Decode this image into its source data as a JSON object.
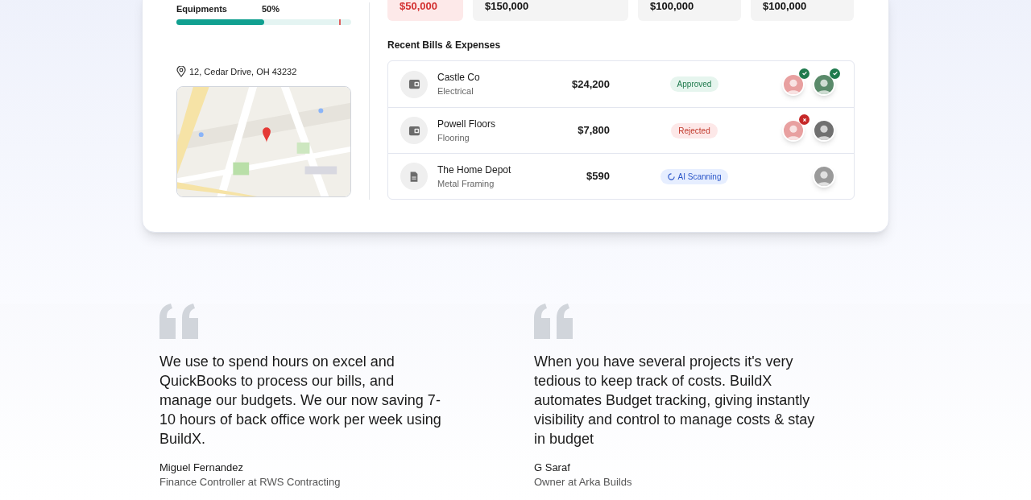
{
  "budget": {
    "label": "Equipments",
    "percent": "50%",
    "level": 0.5
  },
  "address": "12, Cedar Drive, OH 43232",
  "stats": [
    {
      "kind": "overdue",
      "value": "$50,000"
    },
    {
      "kind": "normal",
      "value": "$150,000"
    },
    {
      "kind": "normal",
      "value": "$100,000"
    },
    {
      "kind": "normal",
      "value": "$100,000"
    }
  ],
  "bills_title": "Recent Bills & Expenses",
  "bills": [
    {
      "kind": "wallet",
      "vendor": "Castle Co",
      "category": "Electrical",
      "amount": "$24,200",
      "status": {
        "kind": "approved",
        "label": "Approved"
      },
      "approvers": [
        {
          "kind": "approved",
          "color": "#e8a0a0"
        },
        {
          "kind": "approved",
          "color": "#5a8a6a"
        }
      ]
    },
    {
      "kind": "wallet",
      "vendor": "Powell Floors",
      "category": "Flooring",
      "amount": "$7,800",
      "status": {
        "kind": "rejected",
        "label": "Rejected"
      },
      "approvers": [
        {
          "kind": "rejected",
          "color": "#e8a0a0"
        },
        {
          "kind": "pending",
          "color": "#707070"
        }
      ]
    },
    {
      "kind": "document",
      "vendor": "The Home Depot",
      "category": "Metal Framing",
      "amount": "$590",
      "status": {
        "kind": "scanning",
        "label": "AI Scanning"
      },
      "approvers": [
        {
          "kind": "pending",
          "color": "#9a9a9a"
        }
      ]
    }
  ],
  "testimonials": [
    {
      "quote": "We use to spend hours on excel and QuickBooks to process our bills, and manage our budgets. We our now saving 7-10 hours of back office work per week using BuildX.",
      "name": "Miguel Fernandez",
      "role": "Finance Controller at RWS Contracting"
    },
    {
      "quote": "When you have several projects it's very tedious to keep track of costs. BuildX automates Budget tracking, giving instantly visibility and control to manage costs & stay in budget",
      "name": "G Saraf",
      "role": "Owner at Arka Builds"
    }
  ]
}
